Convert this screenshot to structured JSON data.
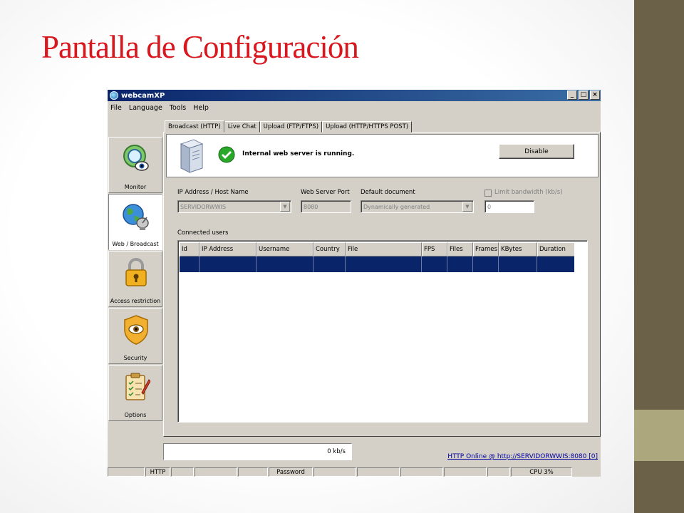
{
  "slide": {
    "title": "Pantalla de Configuración"
  },
  "window": {
    "title": "webcamXP",
    "minimize": "_",
    "maximize": "□",
    "close": "×"
  },
  "menu": [
    {
      "label": "File"
    },
    {
      "label": "Language"
    },
    {
      "label": "Tools"
    },
    {
      "label": "Help"
    }
  ],
  "nav": [
    {
      "label": "Monitor",
      "icon": "monitor-eye-icon"
    },
    {
      "label": "Web / Broadcast",
      "icon": "globe-satellite-icon"
    },
    {
      "label": "Access restriction",
      "icon": "padlock-icon"
    },
    {
      "label": "Security",
      "icon": "shield-eye-icon"
    },
    {
      "label": "Options",
      "icon": "clipboard-icon"
    }
  ],
  "tabs": [
    {
      "label": "Broadcast (HTTP)"
    },
    {
      "label": "Live Chat"
    },
    {
      "label": "Upload (FTP/FTPS)"
    },
    {
      "label": "Upload (HTTP/HTTPS POST)"
    }
  ],
  "server": {
    "status": "Internal web server is running.",
    "disable_label": "Disable"
  },
  "fields": {
    "ip_label": "IP Address / Host Name",
    "ip_value": "SERVIDORWWIS",
    "port_label": "Web Server Port",
    "port_value": "8080",
    "doc_label": "Default document",
    "doc_value": "Dynamically generated",
    "limit_label": "Limit bandwidth (kb/s)",
    "limit_value": "0"
  },
  "users": {
    "label": "Connected users",
    "columns": [
      "Id",
      "IP Address",
      "Username",
      "Country",
      "File",
      "FPS",
      "Files",
      "Frames",
      "KBytes",
      "Duration"
    ]
  },
  "status": {
    "rate": "0 kb/s",
    "online": "HTTP Online @ http://SERVIDORWWIS:8080 [0]",
    "cells": [
      "",
      "HTTP",
      "",
      "",
      "",
      "Password",
      "",
      "",
      "",
      "",
      "",
      "CPU 3%"
    ]
  }
}
